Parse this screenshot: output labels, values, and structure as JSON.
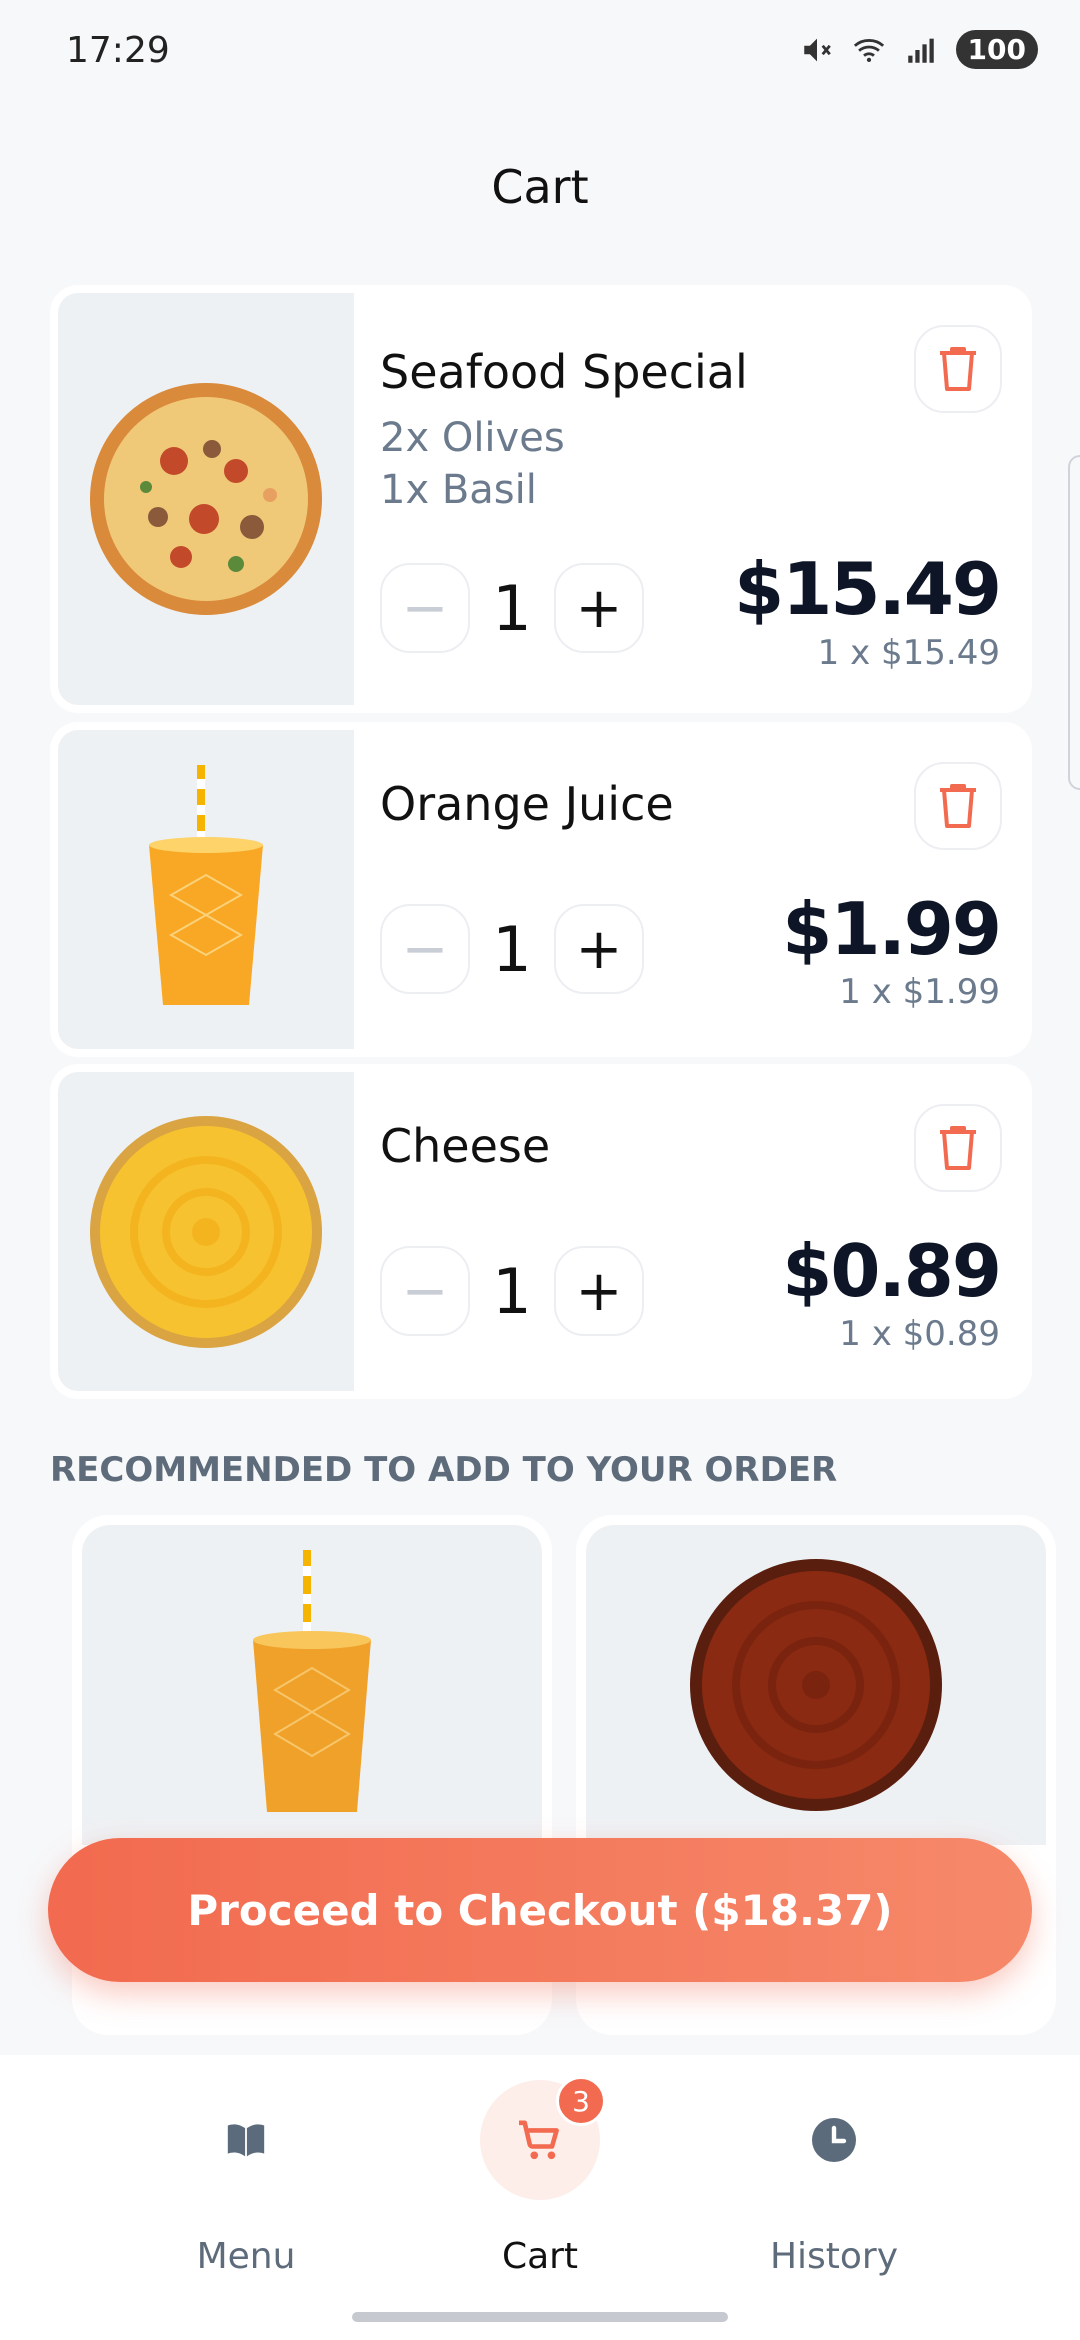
{
  "status_bar": {
    "time": "17:29",
    "battery": "100",
    "icons": [
      "mute-icon",
      "wifi-icon",
      "signal-icon",
      "battery-icon"
    ]
  },
  "page": {
    "title": "Cart"
  },
  "cart_items": [
    {
      "name": "Seafood Special",
      "options": [
        "2x Olives",
        "1x Basil"
      ],
      "quantity": "1",
      "total": "$15.49",
      "unit": "1 x $15.49"
    },
    {
      "name": "Orange Juice",
      "options": [],
      "quantity": "1",
      "total": "$1.99",
      "unit": "1 x $1.99"
    },
    {
      "name": "Cheese",
      "options": [],
      "quantity": "1",
      "total": "$0.89",
      "unit": "1 x $0.89"
    }
  ],
  "controls": {
    "minus": "−",
    "plus": "+"
  },
  "recommended": {
    "heading": "RECOMMENDED TO ADD TO YOUR ORDER",
    "items": [
      "iced-tea-image",
      "bbq-sauce-image"
    ]
  },
  "checkout": {
    "label": "Proceed to Checkout ($18.37)"
  },
  "nav": {
    "items": [
      {
        "label": "Menu",
        "icon": "book-icon"
      },
      {
        "label": "Cart",
        "icon": "cart-icon",
        "badge": "3"
      },
      {
        "label": "History",
        "icon": "clock-icon"
      }
    ]
  },
  "colors": {
    "accent": "#f26a4f",
    "accent_light": "#f6896a",
    "muted_text": "#6b7a8c",
    "price_text": "#0d1526",
    "background": "#f7f8fa"
  }
}
